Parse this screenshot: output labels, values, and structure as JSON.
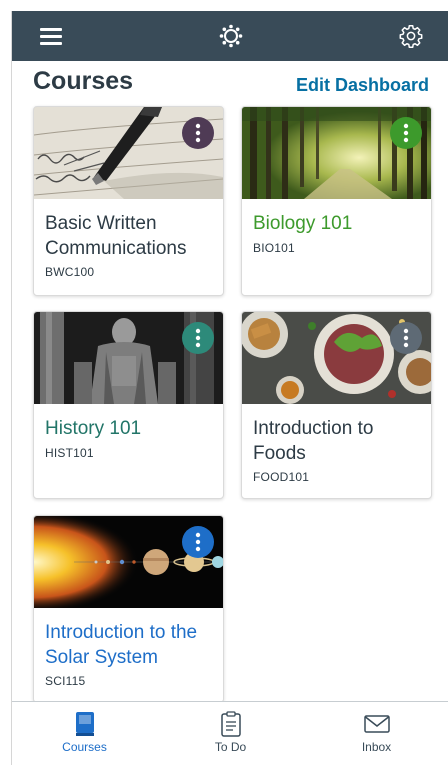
{
  "header": {
    "menu_icon": "hamburger-icon",
    "logo_icon": "canvas-logo-icon",
    "settings_icon": "gear-icon"
  },
  "page": {
    "title": "Courses",
    "edit_link": "Edit Dashboard"
  },
  "courses": [
    {
      "name": "Basic Written Communications",
      "code": "BWC100",
      "color": "#4f3b55",
      "name_color": "#2d3b45",
      "image": "fountain-pen-writing"
    },
    {
      "name": "Biology 101",
      "code": "BIO101",
      "color": "#3d9a2c",
      "name_color": "#3d9a2c",
      "image": "forest-road"
    },
    {
      "name": "History 101",
      "code": "HIST101",
      "color": "#2d8a7a",
      "name_color": "#227568",
      "image": "lincoln-memorial-statue"
    },
    {
      "name": "Introduction to Foods",
      "code": "FOOD101",
      "color": "#5e6a75",
      "name_color": "#2d3b45",
      "image": "food-plates"
    },
    {
      "name": "Introduction to the Solar System",
      "code": "SCI115",
      "color": "#1e6ec8",
      "name_color": "#1e6ec8",
      "image": "solar-system-planets"
    }
  ],
  "tabs": [
    {
      "label": "Courses",
      "icon": "courses-book-icon",
      "active": true,
      "color": "#1e6ec8"
    },
    {
      "label": "To Do",
      "icon": "clipboard-icon",
      "active": false,
      "color": "#394b58"
    },
    {
      "label": "Inbox",
      "icon": "envelope-icon",
      "active": false,
      "color": "#394b58"
    }
  ]
}
